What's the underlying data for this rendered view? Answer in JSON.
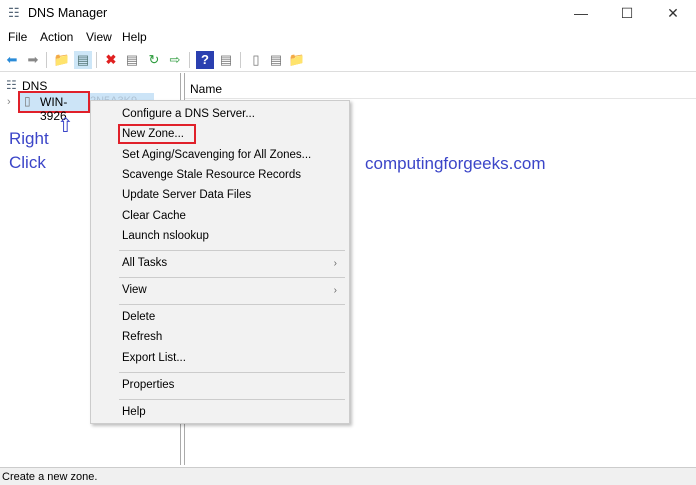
{
  "window": {
    "title": "DNS Manager",
    "minimize": "—",
    "maximize": "☐",
    "close": "✕"
  },
  "menubar": [
    "File",
    "Action",
    "View",
    "Help"
  ],
  "tree": {
    "root": "DNS",
    "server": "WIN-3926",
    "server_rest": "2N5A3K9"
  },
  "list": {
    "column": "Name"
  },
  "context_menu": {
    "items": [
      "Configure a DNS Server...",
      "New Zone...",
      "Set Aging/Scavenging for All Zones...",
      "Scavenge Stale Resource Records",
      "Update Server Data Files",
      "Clear Cache",
      "Launch nslookup",
      "All Tasks",
      "View",
      "Delete",
      "Refresh",
      "Export List...",
      "Properties",
      "Help"
    ]
  },
  "annotation": {
    "line1": "Right",
    "line2": "Click",
    "watermark": "computingforgeeks.com"
  },
  "status": "Create a new zone.",
  "colors": {
    "highlight": "#e0202a",
    "annotation": "#3b45c8"
  }
}
